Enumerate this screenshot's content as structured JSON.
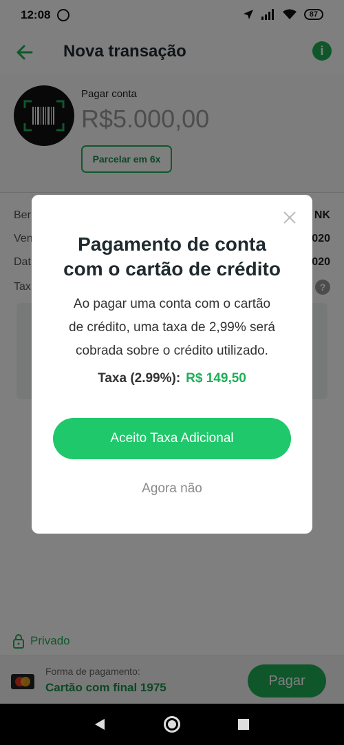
{
  "status_bar": {
    "time": "12:08",
    "battery": "87"
  },
  "appbar": {
    "title": "Nova transação",
    "info": "i"
  },
  "summary": {
    "pay_label": "Pagar conta",
    "amount": "R$5.000,00",
    "installments_button": "Parcelar em 6x"
  },
  "details": {
    "rows": [
      {
        "label": "Ber",
        "value": "NK"
      },
      {
        "label": "Ven",
        "value": "020"
      },
      {
        "label": "Dat",
        "value": "020"
      },
      {
        "label": "Tax",
        "value": ""
      }
    ]
  },
  "bottom": {
    "private_label": "Privado",
    "payment_method_label": "Forma de pagamento:",
    "payment_method_value": "Cartão com final 1975",
    "pay_button": "Pagar"
  },
  "modal": {
    "title_line1": "Pagamento de conta",
    "title_line2": "com o cartão de crédito",
    "text_line1": "Ao pagar uma conta com o cartão",
    "text_line2": "de crédito, uma taxa de 2,99% será",
    "text_line3": "cobrada sobre o crédito utilizado.",
    "fee_label": "Taxa (2.99%):",
    "fee_value": "R$ 149,50",
    "accept_button": "Aceito Taxa Adicional",
    "decline_button": "Agora não"
  }
}
